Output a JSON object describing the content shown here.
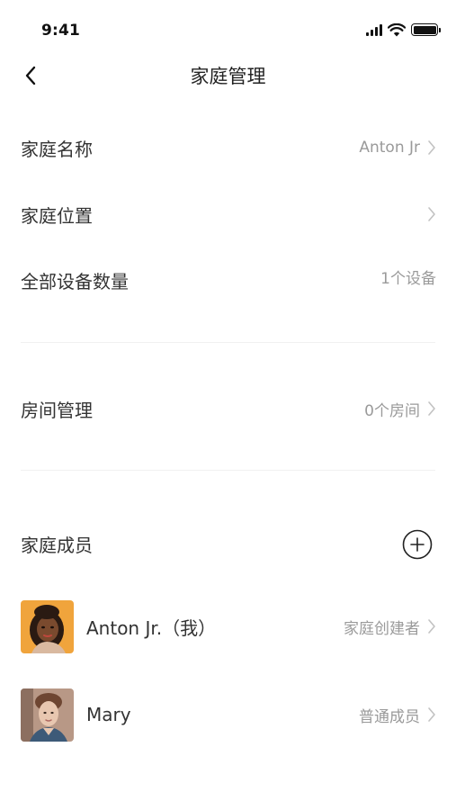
{
  "status_bar": {
    "time": "9:41",
    "signal_icon": "cellular-signal-icon",
    "wifi_icon": "wifi-icon",
    "battery_icon": "battery-icon"
  },
  "nav": {
    "back_icon": "chevron-left-icon",
    "title": "家庭管理"
  },
  "settings": {
    "home_name": {
      "label": "家庭名称",
      "value": "Anton Jr"
    },
    "home_location": {
      "label": "家庭位置",
      "value": ""
    },
    "device_count": {
      "label": "全部设备数量",
      "value": "1个设备"
    },
    "room_management": {
      "label": "房间管理",
      "value": "0个房间"
    }
  },
  "members_section": {
    "title": "家庭成员",
    "add_icon": "plus-circle-icon",
    "members": [
      {
        "name": "Anton Jr.（我）",
        "role": "家庭创建者"
      },
      {
        "name": "Mary",
        "role": "普通成员"
      }
    ]
  },
  "colors": {
    "background": "#ffffff",
    "text_primary": "#333333",
    "text_secondary": "#9a9a9a",
    "divider": "#f1f1f1",
    "avatar1_bg": "#f0a43c"
  }
}
